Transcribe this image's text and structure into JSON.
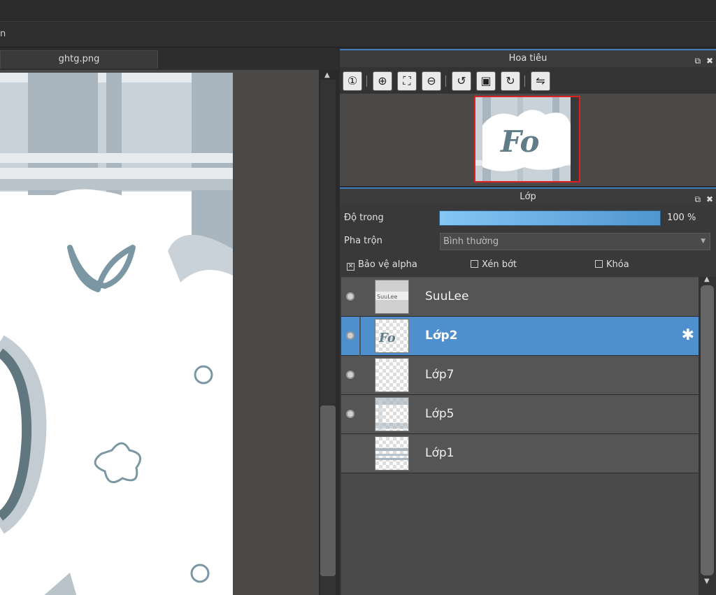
{
  "menubar": {
    "fragment": "n"
  },
  "document_tab": {
    "label": "ghtg.png"
  },
  "navigator": {
    "title": "Hoa tiêu",
    "controls": {
      "popout": "⧉",
      "close": "✖"
    },
    "toolbar": [
      {
        "name": "zoom-actual-icon",
        "glyph": "①"
      },
      {
        "name": "zoom-in-icon",
        "glyph": "⊕"
      },
      {
        "name": "fit-screen-icon",
        "glyph": "⛶"
      },
      {
        "name": "zoom-out-icon",
        "glyph": "⊖"
      },
      {
        "name": "rotate-left-icon",
        "glyph": "↺"
      },
      {
        "name": "fit-window-icon",
        "glyph": "▣"
      },
      {
        "name": "rotate-right-icon",
        "glyph": "↻"
      },
      {
        "name": "flip-icon",
        "glyph": "⇋"
      }
    ],
    "thumb_text": "Fo"
  },
  "layers": {
    "title": "Lớp",
    "opacity_label": "Độ trong",
    "opacity_value": "100 %",
    "opacity_fraction": 1.0,
    "blend_label": "Pha trộn",
    "blend_value": "Bình thường",
    "protect_alpha_label": "Bảo vệ alpha",
    "protect_alpha_checked": true,
    "clip_label": "Xén bớt",
    "clip_checked": false,
    "lock_label": "Khóa",
    "lock_checked": false,
    "items": [
      {
        "name": "SuuLee",
        "visible": true,
        "selected": false,
        "thumb": "text"
      },
      {
        "name": "Lớp2",
        "visible": true,
        "selected": true,
        "thumb": "fo"
      },
      {
        "name": "Lớp7",
        "visible": true,
        "selected": false,
        "thumb": "empty"
      },
      {
        "name": "Lớp5",
        "visible": true,
        "selected": false,
        "thumb": "pattern"
      },
      {
        "name": "Lớp1",
        "visible": false,
        "selected": false,
        "thumb": "stripes"
      }
    ]
  },
  "colors": {
    "accent": "#4d90cd",
    "panel_header_line": "#3f7fbf",
    "plaid": "#a9b6bf",
    "ink": "#5f7c88"
  }
}
